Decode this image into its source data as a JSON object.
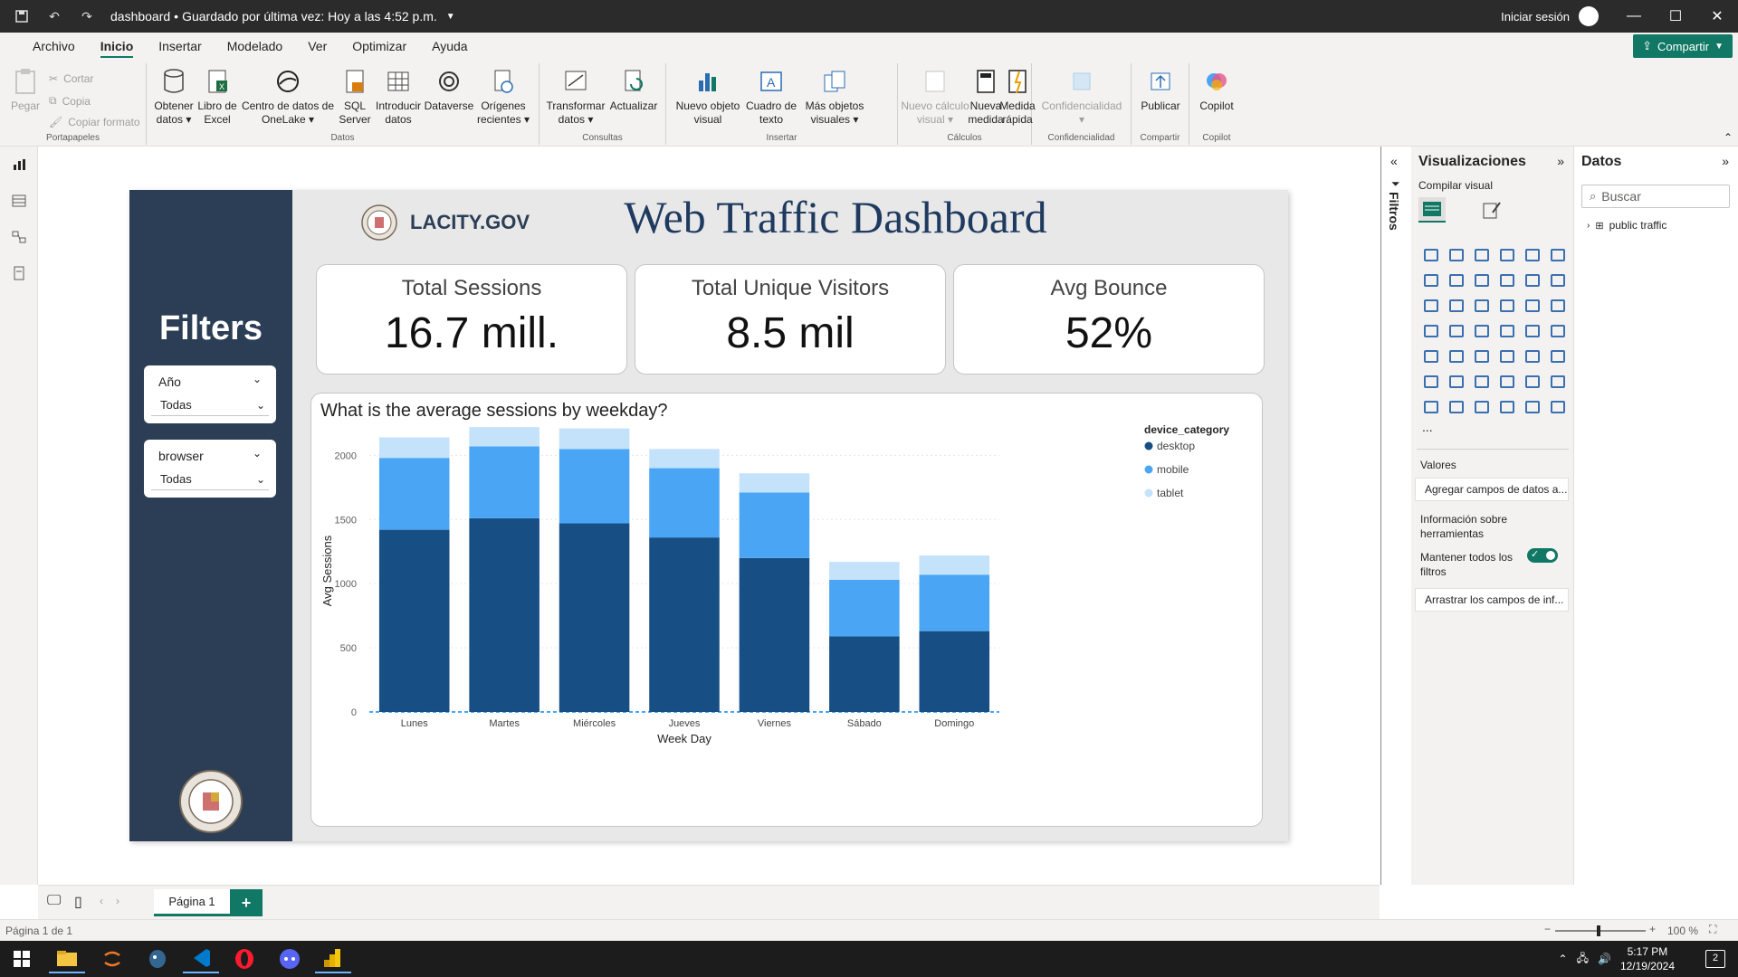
{
  "titlebar": {
    "file_name": "dashboard",
    "save_status": "Guardado por última vez: Hoy a las 4:52 p.m.",
    "signin": "Iniciar sesión"
  },
  "ribbon_tabs": [
    "Archivo",
    "Inicio",
    "Insertar",
    "Modelado",
    "Ver",
    "Optimizar",
    "Ayuda"
  ],
  "share_label": "Compartir",
  "ribbon": {
    "clipboard": {
      "paste": "Pegar",
      "cut": "Cortar",
      "copy": "Copia",
      "format_painter": "Copiar formato",
      "group": "Portapapeles"
    },
    "data": {
      "get_data": [
        "Obtener",
        "datos ▾"
      ],
      "excel": [
        "Libro de",
        "Excel"
      ],
      "onelake": [
        "Centro de datos de",
        "OneLake ▾"
      ],
      "sql": [
        "SQL",
        "Server"
      ],
      "enter": [
        "Introducir",
        "datos"
      ],
      "dataverse": [
        "Dataverse",
        ""
      ],
      "recent": [
        "Orígenes",
        "recientes ▾"
      ],
      "group": "Datos"
    },
    "queries": {
      "transform": [
        "Transformar",
        "datos ▾"
      ],
      "refresh": [
        "Actualizar",
        ""
      ],
      "group": "Consultas"
    },
    "insert": {
      "new_visual": [
        "Nuevo objeto",
        "visual"
      ],
      "textbox": [
        "Cuadro de",
        "texto"
      ],
      "more_visuals": [
        "Más objetos",
        "visuales ▾"
      ],
      "group": "Insertar"
    },
    "calc": {
      "new_calc": [
        "Nuevo cálculo",
        "visual ▾"
      ],
      "new_measure": [
        "Nueva",
        "medida"
      ],
      "quick_measure": [
        "Medida",
        "rápida"
      ],
      "group": "Cálculos"
    },
    "sensitivity": {
      "label": [
        "Confidencialidad",
        "▾"
      ],
      "group": "Confidencialidad"
    },
    "share": {
      "publish": "Publicar",
      "group": "Compartir"
    },
    "copilot": {
      "label": "Copilot",
      "group": "Copilot"
    }
  },
  "report": {
    "filters_title": "Filters",
    "slicers": [
      {
        "label": "Año",
        "value": "Todas"
      },
      {
        "label": "browser",
        "value": "Todas"
      }
    ],
    "logo_text": "LACITY.GOV",
    "title": "Web Traffic Dashboard",
    "kpis": [
      {
        "label": "Total Sessions",
        "value": "16.7 mill."
      },
      {
        "label": "Total Unique Visitors",
        "value": "8.5 mil"
      },
      {
        "label": "Avg Bounce",
        "value": "52%"
      }
    ]
  },
  "chart_data": {
    "type": "bar",
    "stacked": true,
    "title": "What is the average sessions by weekday?",
    "xlabel": "Week Day",
    "ylabel": "Avg Sessions",
    "categories": [
      "Lunes",
      "Martes",
      "Miércoles",
      "Jueves",
      "Viernes",
      "Sábado",
      "Domingo"
    ],
    "ylim": [
      0,
      2200
    ],
    "yticks": [
      0,
      500,
      1000,
      1500,
      2000
    ],
    "legend_title": "device_category",
    "legend_position": "top-right",
    "series": [
      {
        "name": "desktop",
        "color": "#174f84",
        "values": [
          1420,
          1510,
          1470,
          1360,
          1200,
          590,
          630
        ]
      },
      {
        "name": "mobile",
        "color": "#4aa6f5",
        "values": [
          560,
          560,
          580,
          540,
          510,
          440,
          440
        ]
      },
      {
        "name": "tablet",
        "color": "#c5e2fb",
        "values": [
          160,
          150,
          160,
          150,
          150,
          140,
          150
        ]
      }
    ],
    "gridlines": true
  },
  "filters_pane": {
    "label": "Filtros"
  },
  "viz_pane": {
    "title": "Visualizaciones",
    "build_label": "Compilar visual",
    "values_label": "Valores",
    "values_placeholder": "Agregar campos de datos a...",
    "tooltips_label": "Información sobre herramientas",
    "keep_filters_label": "Mantener todos los filtros",
    "drill_placeholder": "Arrastrar los campos de inf...",
    "more": "..."
  },
  "data_pane": {
    "title": "Datos",
    "search_placeholder": "Buscar",
    "tables": [
      "public traffic"
    ]
  },
  "pages": {
    "current": "Página 1",
    "status": "Página 1 de 1",
    "zoom": "100 %"
  },
  "taskbar": {
    "time": "5:17 PM",
    "date": "12/19/2024",
    "notif_count": "2"
  }
}
